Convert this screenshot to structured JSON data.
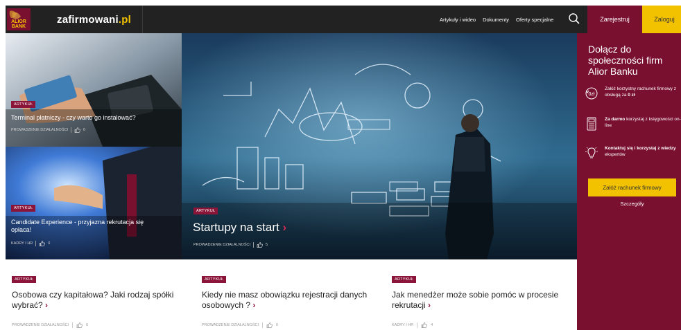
{
  "header": {
    "logo_line1": "ALIOR",
    "logo_line2": "BANK",
    "site_name": "zafirmowani",
    "site_tld": ".pl",
    "nav": [
      "Artykuły i wideo",
      "Dokumenty",
      "Oferty specjalne"
    ],
    "register_label": "Zarejestruj",
    "login_label": "Zaloguj"
  },
  "tiles": [
    {
      "badge": "ARTYKUŁ",
      "title": "Terminal płatniczy - czy warto go instalować?",
      "category": "PROWADZENIE DZIAŁALNOŚCI",
      "likes": "0"
    },
    {
      "badge": "ARTYKUŁ",
      "title": "Candidate Experience - przyjazna rekrutacja się opłaca!",
      "category": "KADRY I HR",
      "likes": "0"
    },
    {
      "badge": "ARTYKUŁ",
      "title": "Startupy na start",
      "category": "PROWADZENIE DZIAŁALNOŚCI",
      "likes": "5"
    }
  ],
  "side": {
    "heading": "Dołącz do społeczności firm Alior Banku",
    "benefit1_a": "Załóż korzystny rachunek firmowy z obsługą za ",
    "benefit1_b": "0 zł",
    "benefit2_a": "Za darmo",
    "benefit2_b": " korzystaj z księgowości on-line",
    "benefit3_a": "Kontaktuj się i korzystaj z wiedzy",
    "benefit3_b": " ekspertów",
    "cta": "Załóż rachunek firmowy",
    "details": "Szczegóły"
  },
  "articles": [
    {
      "badge": "ARTYKUŁ",
      "title": "Osobowa czy kapitałowa? Jaki rodzaj spółki wybrać?",
      "category": "PROWADZENIE DZIAŁALNOŚCI",
      "likes": "0"
    },
    {
      "badge": "ARTYKUŁ",
      "title": "Kiedy nie masz obowiązku rejestracji danych osobowych ?",
      "category": "PROWADZENIE DZIAŁALNOŚCI",
      "likes": "0"
    },
    {
      "badge": "ARTYKUŁ",
      "title": "Jak menedżer może sobie pomóc w procesie rekrutacji",
      "category": "KADRY I HR",
      "likes": "4"
    }
  ],
  "colors": {
    "brand": "#7a1030",
    "accent": "#f2c200",
    "badge": "#8b1538",
    "header_bg": "#222222"
  }
}
